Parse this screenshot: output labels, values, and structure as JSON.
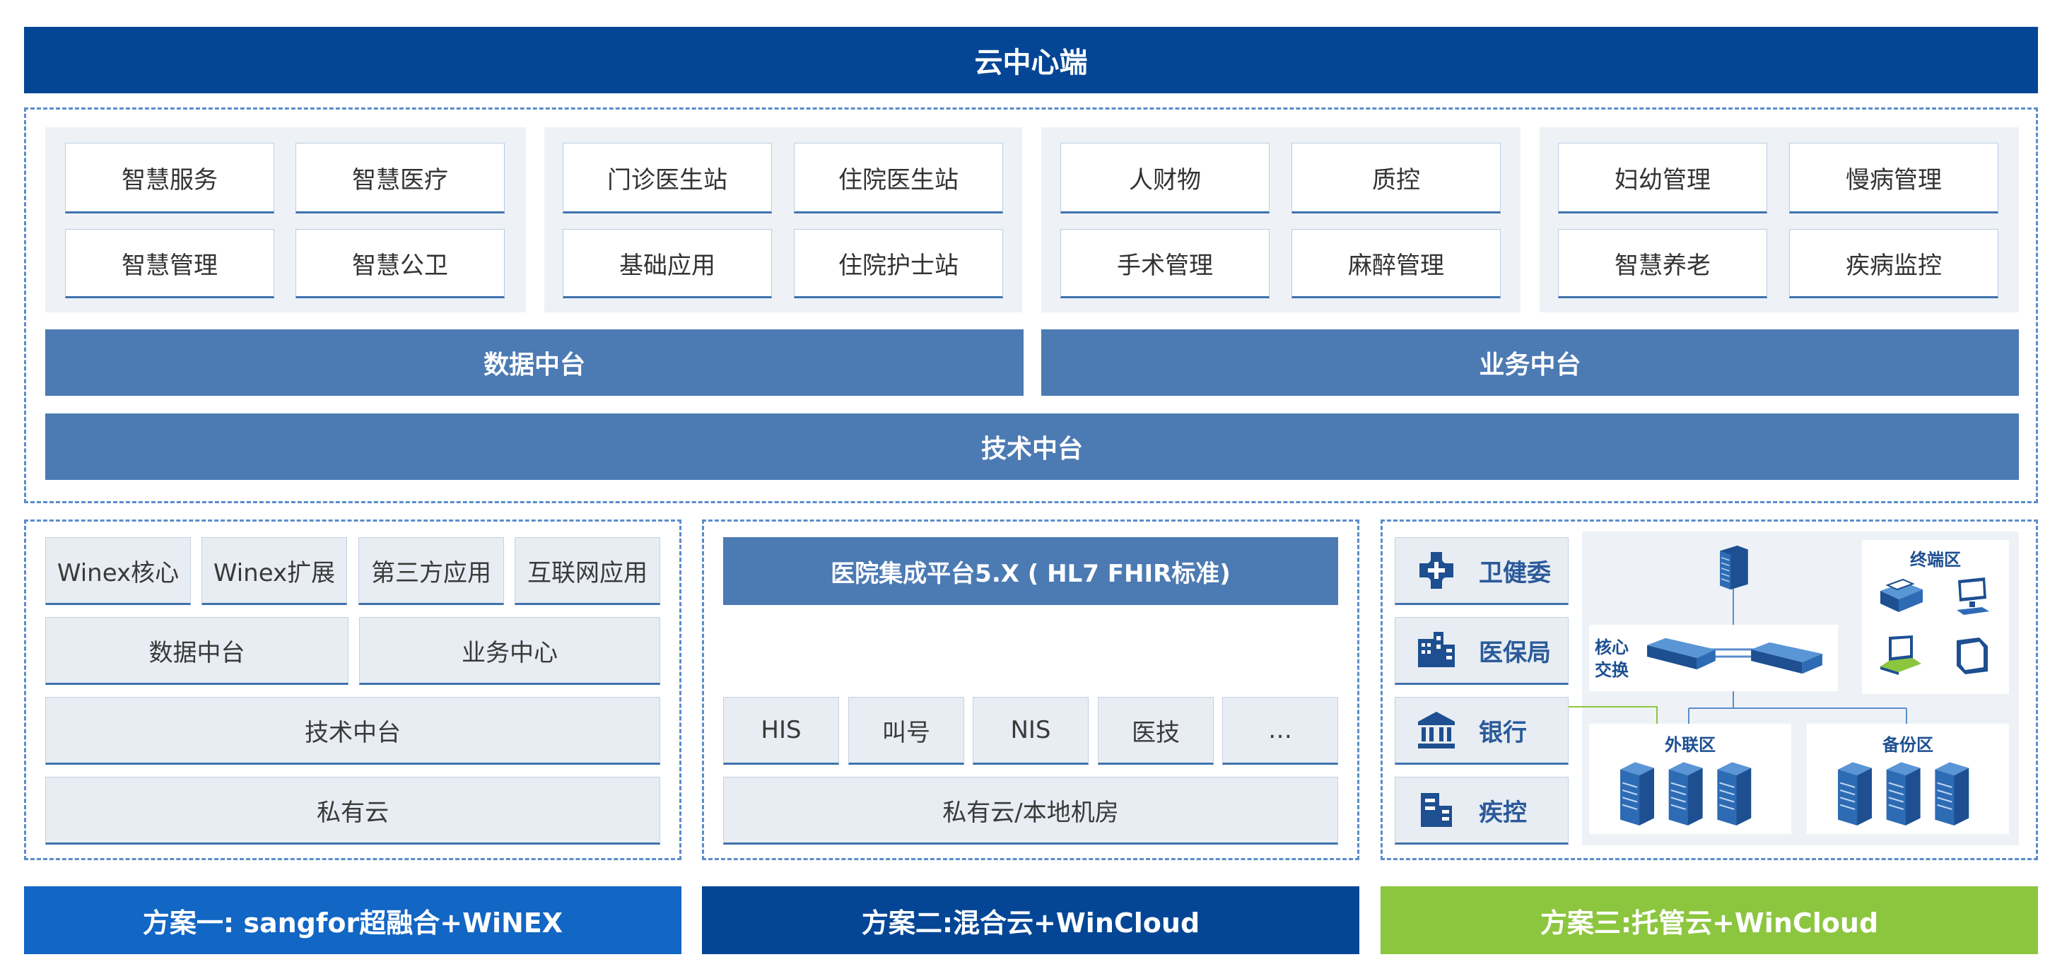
{
  "header": {
    "title": "云中心端"
  },
  "app_groups": [
    {
      "items": [
        "智慧服务",
        "智慧医疗",
        "智慧管理",
        "智慧公卫"
      ]
    },
    {
      "items": [
        "门诊医生站",
        "住院医生站",
        "基础应用",
        "住院护士站"
      ]
    },
    {
      "items": [
        "人财物",
        "质控",
        "手术管理",
        "麻醉管理"
      ]
    },
    {
      "items": [
        "妇幼管理",
        "慢病管理",
        "智慧养老",
        "疾病监控"
      ]
    }
  ],
  "platform": {
    "data": "数据中台",
    "business": "业务中台",
    "tech": "技术中台"
  },
  "plan1": {
    "top": [
      "Winex核心",
      "Winex扩展",
      "第三方应用",
      "互联网应用"
    ],
    "mid": [
      "数据中台",
      "业务中心"
    ],
    "tech": "技术中台",
    "cloud": "私有云",
    "footer": "方案一: sangfor超融合+WiNEX"
  },
  "plan2": {
    "platform": "医院集成平台5.X ( HL7 FHIR标准)",
    "systems": [
      "HIS",
      "叫号",
      "NIS",
      "医技",
      "…"
    ],
    "cloud": "私有云/本地机房",
    "footer": "方案二:混合云+WinCloud"
  },
  "plan3": {
    "orgs": [
      {
        "label": "卫健委",
        "icon": "medical-cross-icon"
      },
      {
        "label": "医保局",
        "icon": "building-icon"
      },
      {
        "label": "银行",
        "icon": "bank-icon"
      },
      {
        "label": "疾控",
        "icon": "office-icon"
      }
    ],
    "core_label": "核心\n交换",
    "core_line1": "核心",
    "core_line2": "交换",
    "terminal_zone": "终端区",
    "external_zone": "外联区",
    "backup_zone": "备份区",
    "footer": "方案三:托管云+WinCloud"
  },
  "colors": {
    "header": "#044695",
    "platform_bar": "#4c7ab3",
    "plan1_footer": "#1266c4",
    "plan2_footer": "#044695",
    "plan3_footer": "#8cc63f",
    "dashed_border": "#5b8ccc"
  }
}
